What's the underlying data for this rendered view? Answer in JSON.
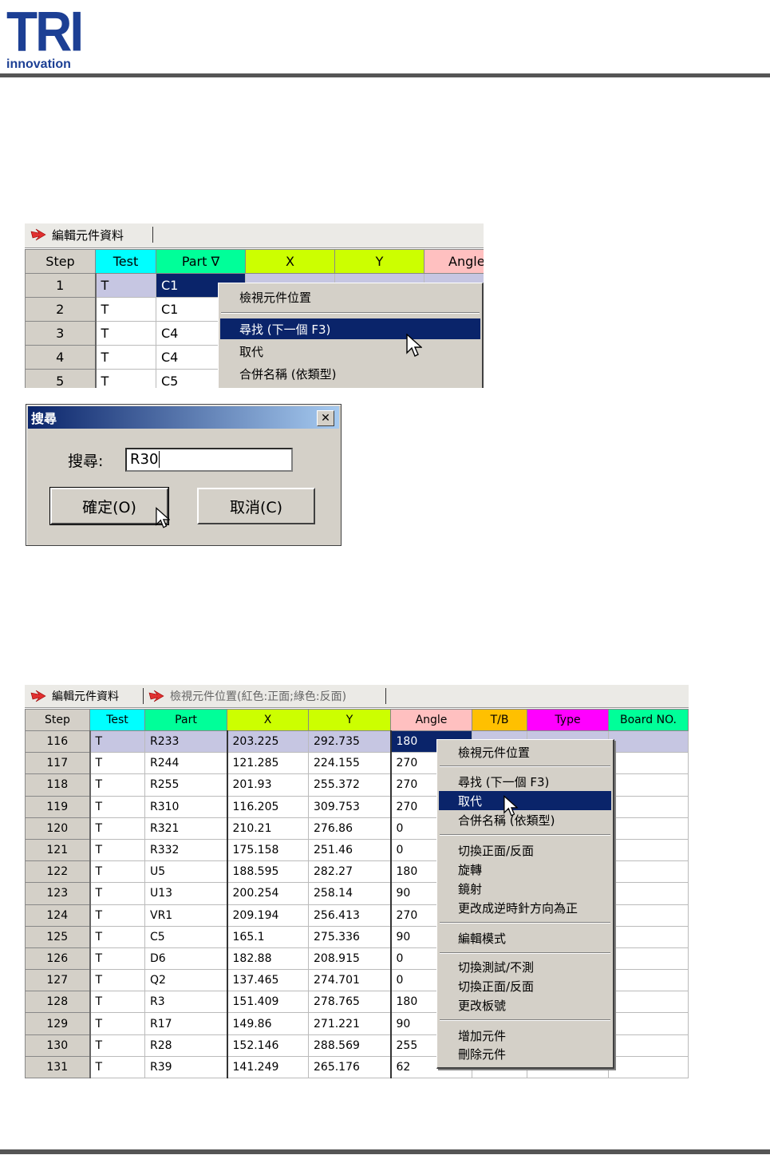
{
  "logo": {
    "brand": "TRI",
    "sub": "innovation",
    "color": "#1c3f94"
  },
  "top_shot": {
    "tab_label": "編輯元件資料",
    "columns": [
      {
        "label": "Step",
        "color": "#d4d0c8"
      },
      {
        "label": "Test",
        "color": "#00ffff"
      },
      {
        "label": "Part ∇",
        "color": "#00ff99"
      },
      {
        "label": "X",
        "color": "#ccff00"
      },
      {
        "label": "Y",
        "color": "#ccff00"
      },
      {
        "label": "Angle",
        "color": "#ffc0c0"
      }
    ],
    "rows": [
      {
        "step": "1",
        "test": "T",
        "part": "C1"
      },
      {
        "step": "2",
        "test": "T",
        "part": "C1"
      },
      {
        "step": "3",
        "test": "T",
        "part": "C4"
      },
      {
        "step": "4",
        "test": "T",
        "part": "C4"
      },
      {
        "step": "5",
        "test": "T",
        "part": "C5"
      }
    ],
    "menu": [
      "檢視元件位置",
      "尋找 (下一個 F3)",
      "取代",
      "合併名稱 (依類型)"
    ]
  },
  "dialog": {
    "title": "搜尋",
    "label": "搜尋:",
    "value": "R30",
    "ok": "確定(O)",
    "cancel": "取消(C)"
  },
  "bottom_shot": {
    "tab1": "編輯元件資料",
    "tab2": "檢視元件位置(紅色:正面;綠色:反面)",
    "columns": [
      {
        "label": "Step",
        "color": "#d4d0c8"
      },
      {
        "label": "Test",
        "color": "#00ffff"
      },
      {
        "label": "Part",
        "color": "#00ff99"
      },
      {
        "label": "X",
        "color": "#ccff00"
      },
      {
        "label": "Y",
        "color": "#ccff00"
      },
      {
        "label": "Angle",
        "color": "#ffc0c0"
      },
      {
        "label": "T/B",
        "color": "#ffc000"
      },
      {
        "label": "Type",
        "color": "#ff00ff"
      },
      {
        "label": "Board NO.",
        "color": "#00ff99"
      }
    ],
    "rows": [
      {
        "step": "116",
        "test": "T",
        "part": "R233",
        "x": "203.225",
        "y": "292.735",
        "angle": "180"
      },
      {
        "step": "117",
        "test": "T",
        "part": "R244",
        "x": "121.285",
        "y": "224.155",
        "angle": "270"
      },
      {
        "step": "118",
        "test": "T",
        "part": "R255",
        "x": "201.93",
        "y": "255.372",
        "angle": "270"
      },
      {
        "step": "119",
        "test": "T",
        "part": "R310",
        "x": "116.205",
        "y": "309.753",
        "angle": "270"
      },
      {
        "step": "120",
        "test": "T",
        "part": "R321",
        "x": "210.21",
        "y": "276.86",
        "angle": "0"
      },
      {
        "step": "121",
        "test": "T",
        "part": "R332",
        "x": "175.158",
        "y": "251.46",
        "angle": "0"
      },
      {
        "step": "122",
        "test": "T",
        "part": "U5",
        "x": "188.595",
        "y": "282.27",
        "angle": "180"
      },
      {
        "step": "123",
        "test": "T",
        "part": "U13",
        "x": "200.254",
        "y": "258.14",
        "angle": "90"
      },
      {
        "step": "124",
        "test": "T",
        "part": "VR1",
        "x": "209.194",
        "y": "256.413",
        "angle": "270"
      },
      {
        "step": "125",
        "test": "T",
        "part": "C5",
        "x": "165.1",
        "y": "275.336",
        "angle": "90"
      },
      {
        "step": "126",
        "test": "T",
        "part": "D6",
        "x": "182.88",
        "y": "208.915",
        "angle": "0"
      },
      {
        "step": "127",
        "test": "T",
        "part": "Q2",
        "x": "137.465",
        "y": "274.701",
        "angle": "0"
      },
      {
        "step": "128",
        "test": "T",
        "part": "R3",
        "x": "151.409",
        "y": "278.765",
        "angle": "180"
      },
      {
        "step": "129",
        "test": "T",
        "part": "R17",
        "x": "149.86",
        "y": "271.221",
        "angle": "90"
      },
      {
        "step": "130",
        "test": "T",
        "part": "R28",
        "x": "152.146",
        "y": "288.569",
        "angle": "255"
      },
      {
        "step": "131",
        "test": "T",
        "part": "R39",
        "x": "141.249",
        "y": "265.176",
        "angle": "62"
      }
    ],
    "menu": [
      "檢視元件位置",
      "尋找 (下一個 F3)",
      "取代",
      "合併名稱 (依類型)",
      "切換正面/反面",
      "旋轉",
      "鏡射",
      "更改成逆時針方向為正",
      "編輯模式",
      "切換測試/不測",
      "切換正面/反面",
      "更改板號",
      "增加元件",
      "刪除元件"
    ]
  }
}
